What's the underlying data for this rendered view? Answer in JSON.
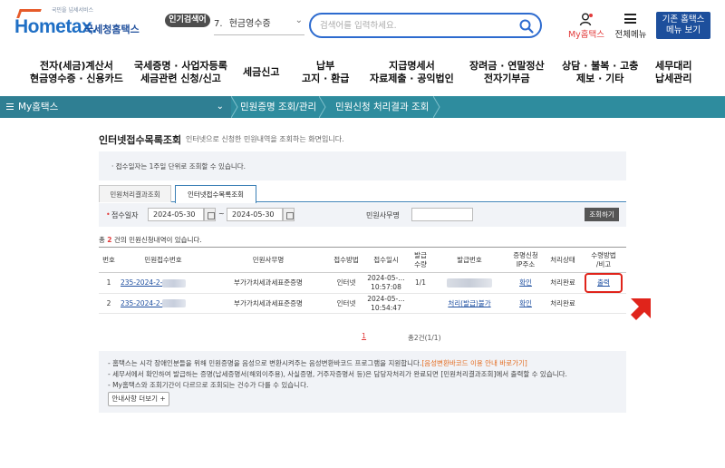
{
  "header": {
    "logo_sub": "국민을 넘세서비스",
    "logo_main": "Hometax.",
    "logo_name": "국세청홈택스",
    "popular_label": "인기검색어",
    "popular_num": "7.",
    "popular_item": "현금영수증",
    "search_placeholder": "검색어를 입력하세요.",
    "my_hometax": "My홈택스",
    "all_menu": "전체메뉴",
    "legacy_line1": "기존 홈택스",
    "legacy_line2": "메뉴 보기"
  },
  "main_menu": [
    {
      "l1": "전자(세금)계산서",
      "l2": "현금영수증 · 신용카드"
    },
    {
      "l1": "국세증명 · 사업자등록",
      "l2": "세금관련 신청/신고"
    },
    {
      "l1": "세금신고",
      "l2": ""
    },
    {
      "l1": "납부",
      "l2": "고지 · 환급"
    },
    {
      "l1": "지급명세서",
      "l2": "자료제출 · 공익법인"
    },
    {
      "l1": "장려금 · 연말정산",
      "l2": "전자기부금"
    },
    {
      "l1": "상담 · 불복 · 고충",
      "l2": "제보 · 기타"
    },
    {
      "l1": "세무대리",
      "l2": "납세관리"
    }
  ],
  "breadcrumb": {
    "home": "My홈택스",
    "level1": "민원증명 조회/관리",
    "level2": "민원신청 처리결과 조회"
  },
  "page": {
    "title": "인터넷접수목록조회",
    "desc": "인터넷으로 신청한 민원내역을 조회하는 화면입니다.",
    "notice1": "· 접수일자는 1주일 단위로 조회할 수 있습니다."
  },
  "tabs": [
    "민원처리결과조회",
    "인터넷접수목록조회"
  ],
  "filter": {
    "req_mark": "•",
    "date_label": "접수일자",
    "date_from": "2024-05-30",
    "tilde": "~",
    "date_to": "2024-05-30",
    "civil_label": "민원사무명",
    "query_btn": "조회하기"
  },
  "count": {
    "pre": "총 ",
    "num": "2",
    "post": " 건의 민원신청내역이 있습니다."
  },
  "table": {
    "headers": [
      "번호",
      "민원접수번호",
      "민원사무명",
      "접수방법",
      "접수일시",
      "발급\n수량",
      "발급번호",
      "증명신청\nIP주소",
      "처리상태",
      "수령방법\n/비고"
    ],
    "rows": [
      {
        "no": "1",
        "receipt": "235-2024-2-",
        "name": "부가가치세과세표준증명",
        "method": "인터넷",
        "dt1": "2024-05-…",
        "dt2": "10:57:08",
        "qty": "1/1",
        "issue": "",
        "ip": "확인",
        "status": "처리완료",
        "note": "출력"
      },
      {
        "no": "2",
        "receipt": "235-2024-2-",
        "name": "부가가치세과세표준증명",
        "method": "인터넷",
        "dt1": "2024-05-…",
        "dt2": "10:54:47",
        "qty": "",
        "issue": "처리(발급)불가",
        "ip": "확인",
        "status": "처리완료",
        "note": ""
      }
    ]
  },
  "pager": {
    "page": "1",
    "info": "총2건(1/1)"
  },
  "notice2": {
    "line1_a": "- 홈택스는 시각 장애인분들을 위해 민원증명을 음성으로 변환시켜주는 음성변환바코드 프로그램을 지원합니다.",
    "line1_b": "[음성변환바코드 이용 안내 바로가기]",
    "line2": "- 세무서에서 확인하여 발급하는 증명(납세증명서(해외이주용), 사실증명, 거주자증명서 등)은 담당자처리가 완료되면 [민원처리결과조회]에서 출력할 수 있습니다.",
    "line3": "- My홈택스와 조회기간이 다르므로 조회되는 건수가 다를 수 있습니다.",
    "more_btn": "안내사항 더보기 +"
  },
  "colors": {
    "accent": "#2d6bcf",
    "crumb_bar": "#2e8c9e",
    "highlight": "#e0241b"
  }
}
